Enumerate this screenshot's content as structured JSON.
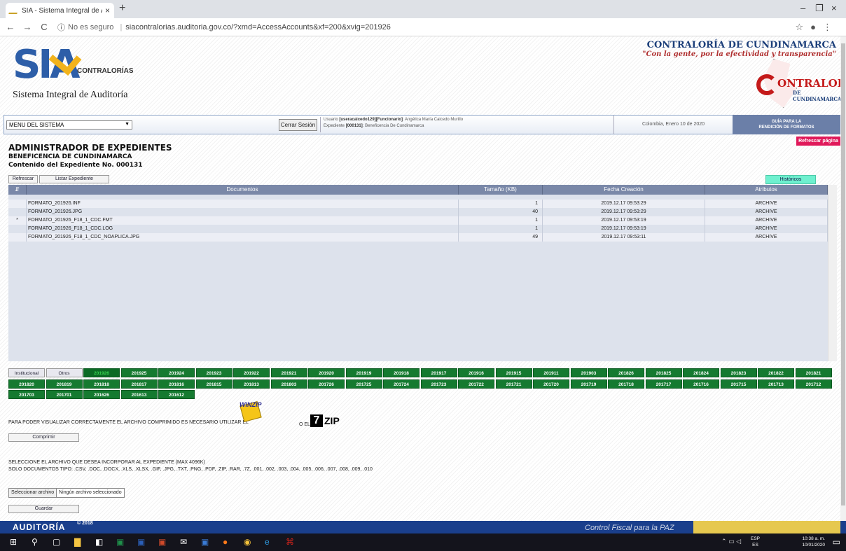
{
  "browser": {
    "tab_title": "SIA - Sistema Integral de Auditor",
    "tab_close": "×",
    "new_tab": "+",
    "url_security": "No es seguro",
    "url": "siacontralorias.auditoria.gov.co/?xmd=AccessAccounts&xf=200&xvig=201926",
    "win_min": "–",
    "win_max": "❐",
    "win_close": "×"
  },
  "header": {
    "logo_letters": "SIA",
    "logo_contralorias": "CONTRALORÍAS",
    "logo_subtitle": "Sistema Integral de Auditoría",
    "entity_name": "CONTRALORÍA DE CUNDINAMARCA",
    "entity_slogan": "\"Con la gente, por la efectividad y transparencia\"",
    "emblem_word": "ONTRALORIA",
    "emblem_sub": "DE CUNDINAMARCA"
  },
  "menubar": {
    "menu_select": "MENU DEL SISTEMA",
    "logout": "Cerrar Sesión",
    "user_line_prefix": "Usuario ",
    "user_id": "[useracaicedo129][Funcionario]",
    "user_name": ": Angélica María Caicedo Murillo",
    "exp_prefix": "Expediente ",
    "exp_id": "[000131]",
    "exp_name": ": Beneficencia De Cundinamarca",
    "date": "Colombia, Enero 10 de 2020",
    "guide_line1": "GUÍA PARA LA",
    "guide_line2": "RENDICIÓN DE FORMATOS",
    "refresh_page": "Refrescar página"
  },
  "main": {
    "title": "ADMINISTRADOR DE EXPEDIENTES",
    "entity": "BENEFICENCIA DE CUNDINAMARCA",
    "content": "Contenido del Expediente No. 000131",
    "btn_refresh": "Refrescar",
    "btn_list": "Listar Expediente",
    "btn_history": "Históricos"
  },
  "table": {
    "columns": [
      "Documentos",
      "Tamaño (KB)",
      "Fecha Creación",
      "Atributos"
    ],
    "rows": [
      {
        "mark": "",
        "name": "FORMATO_201926.INF",
        "size": "1",
        "date": "2019.12.17 09:53:29",
        "attr": "ARCHIVE"
      },
      {
        "mark": "",
        "name": "FORMATO_201926.JPG",
        "size": "40",
        "date": "2019.12.17 09:53:29",
        "attr": "ARCHIVE"
      },
      {
        "mark": "*",
        "name": "FORMATO_201926_F18_1_CDC.FMT",
        "size": "1",
        "date": "2019.12.17 09:53:19",
        "attr": "ARCHIVE"
      },
      {
        "mark": "",
        "name": "FORMATO_201926_F18_1_CDC.LOG",
        "size": "1",
        "date": "2019.12.17 09:53:19",
        "attr": "ARCHIVE"
      },
      {
        "mark": "",
        "name": "FORMATO_201926_F18_1_CDC_NOAPLICA.JPG",
        "size": "49",
        "date": "2019.12.17 09:53:11",
        "attr": "ARCHIVE"
      }
    ]
  },
  "period_tabs": [
    "Institucional",
    "Otros",
    "201926",
    "201925",
    "201924",
    "201923",
    "201922",
    "201921",
    "201920",
    "201919",
    "201918",
    "201917",
    "201916",
    "201915",
    "201911",
    "201903",
    "201826",
    "201825",
    "201824",
    "201823",
    "201822",
    "201821",
    "201820",
    "201819",
    "201818",
    "201817",
    "201816",
    "201815",
    "201813",
    "201803",
    "201726",
    "201725",
    "201724",
    "201723",
    "201722",
    "201721",
    "201720",
    "201719",
    "201718",
    "201717",
    "201716",
    "201715",
    "201713",
    "201712",
    "201703",
    "201701",
    "201626",
    "201613",
    "201612"
  ],
  "active_tab": "201926",
  "zip": {
    "notice": "PARA PODER VISUALIZAR CORRECTAMENTE EL ARCHIVO COMPRIMIDO ES NECESARIO UTILIZAR EL",
    "winzip_label": "WINZIP",
    "or_label": "O EL",
    "zip7_seven": "7",
    "zip7_zip": "ZIP",
    "btn_compress": "Comprimir"
  },
  "upload": {
    "line1": "SELECCIONE EL ARCHIVO QUE DESEA INCORPORAR AL EXPEDIENTE (MAX 4096K)",
    "line2": "SOLO DOCUMENTOS TIPO: .CSV, .DOC, .DOCX, .XLS, .XLSX, .GIF, .JPG, .TXT, .PNG, .PDF, .ZIP, .RAR, .7Z, .001, .002, .003, .004, .005, .006, .007, .008, .009, .010",
    "btn_choose": "Seleccionar archivo",
    "no_file": "Ningún archivo seleccionado",
    "btn_save": "Guardar"
  },
  "footer": {
    "brand": "AUDITORÍA",
    "year": "© 2018",
    "slogan": "Control Fiscal para la PAZ"
  },
  "taskbar": {
    "lang_top": "ESP",
    "lang_bottom": "ES",
    "time": "10:38 a. m.",
    "date": "10/01/2020"
  }
}
